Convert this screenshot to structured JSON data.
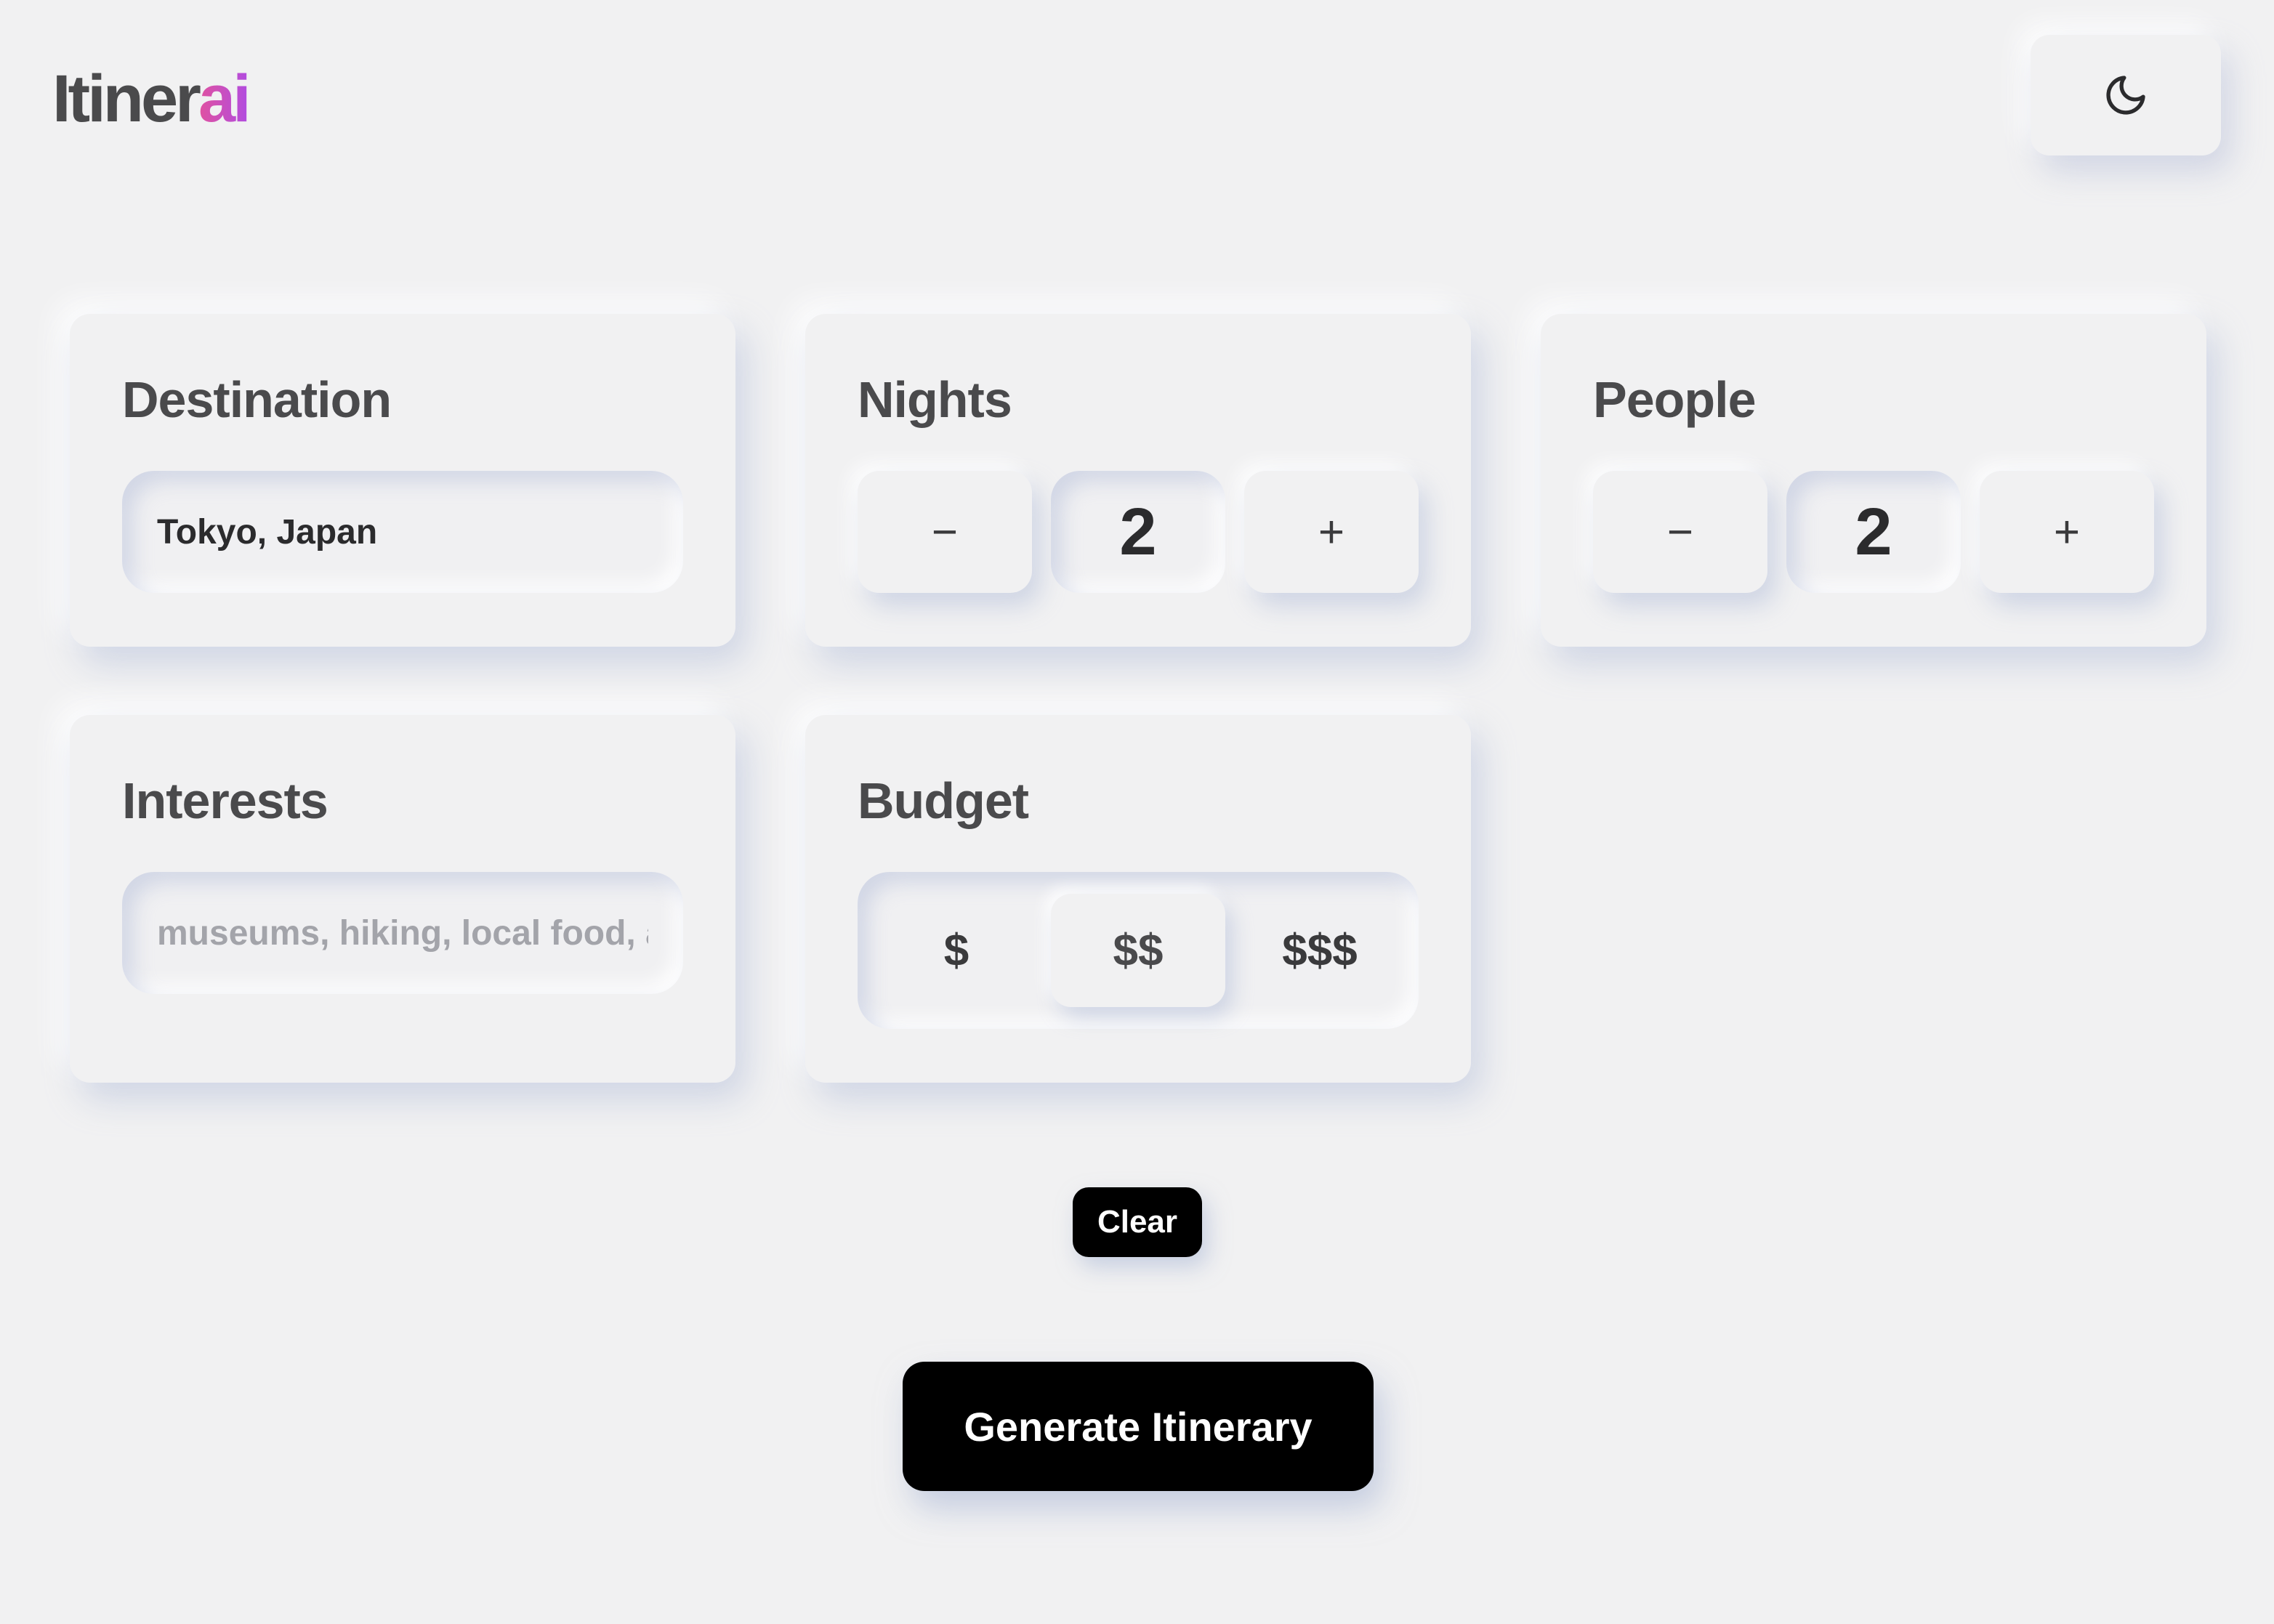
{
  "header": {
    "logo_main": "Itiner",
    "logo_accent": "ai",
    "theme_toggle_icon": "moon-icon"
  },
  "destination": {
    "title": "Destination",
    "value": "Tokyo, Japan",
    "placeholder": ""
  },
  "nights": {
    "title": "Nights",
    "decrement_label": "−",
    "value": "2",
    "increment_label": "+"
  },
  "people": {
    "title": "People",
    "decrement_label": "−",
    "value": "2",
    "increment_label": "+"
  },
  "interests": {
    "title": "Interests",
    "value": "",
    "placeholder": "museums, hiking, local food, art"
  },
  "budget": {
    "title": "Budget",
    "options": [
      "$",
      "$$",
      "$$$"
    ],
    "selected": "$$"
  },
  "actions": {
    "clear_label": "Clear",
    "generate_label": "Generate Itinerary"
  },
  "colors": {
    "background": "#f1f1f2",
    "logo_gradient_start": "#e052a0",
    "logo_gradient_end": "#b14ce0",
    "primary_button": "#000000"
  }
}
